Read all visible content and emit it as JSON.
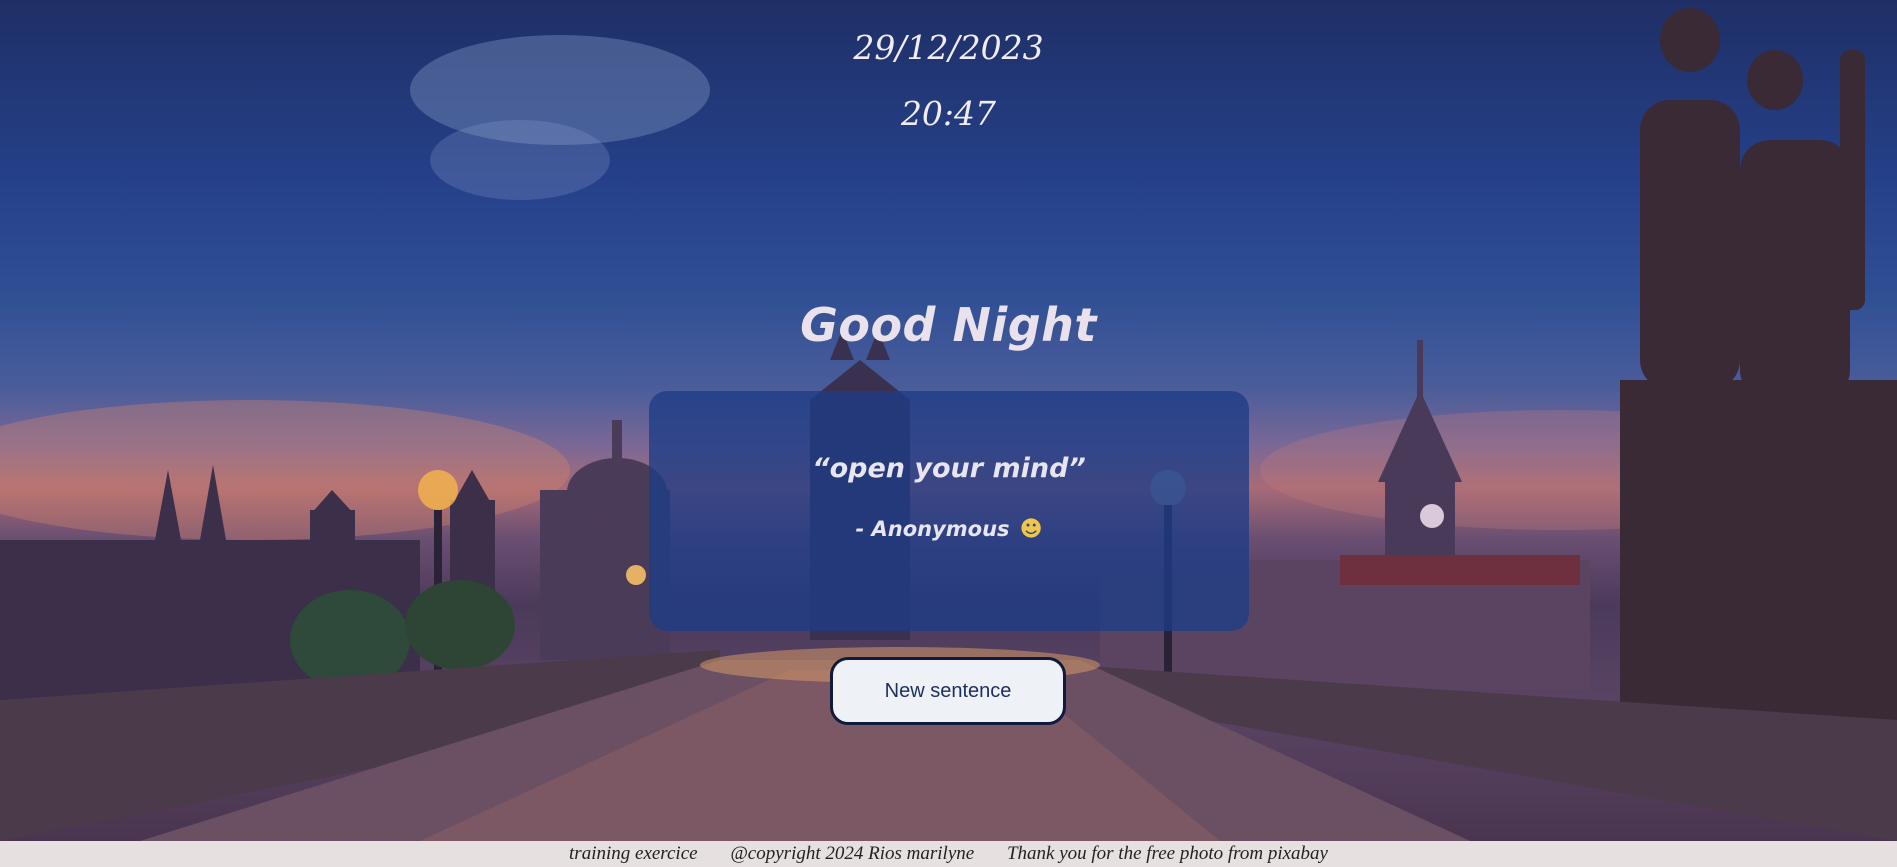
{
  "clock": {
    "date": "29/12/2023",
    "time": "20:47"
  },
  "greeting": "Good Night",
  "quote": {
    "text": "“open your mind”",
    "author": "- Anonymous",
    "icon": "performing-arts-masks-icon"
  },
  "actions": {
    "new_sentence_label": "New sentence"
  },
  "footer": {
    "item1": "training exercice",
    "item2": "@copyright 2024 Rios marilyne",
    "item3": "Thank you for the free photo from pixabay"
  },
  "colors": {
    "card": "#1e3c87",
    "button_bg": "#eef1f6",
    "button_border": "#101a3a",
    "footer_bg": "#e6e0e0"
  }
}
